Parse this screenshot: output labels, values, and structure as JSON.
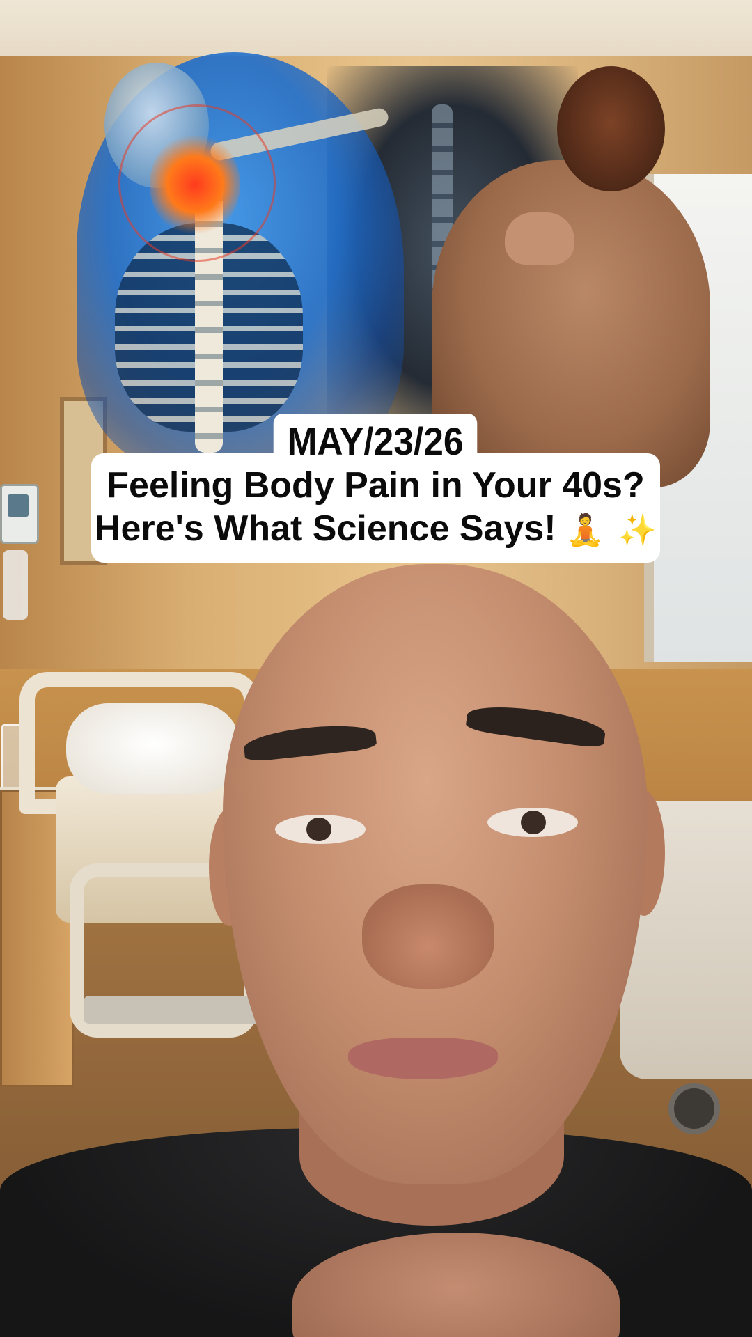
{
  "video": {
    "caption_date": "MAY/23/26",
    "caption_line1": "Feeling Body Pain in Your 40s?",
    "caption_line2": "Here's What Science Says!",
    "caption_emoji1": "🧘",
    "caption_emoji2": "✨"
  },
  "icons": {
    "emoji1": "person-meditating-emoji",
    "emoji2": "sparkles-emoji"
  },
  "colors": {
    "caption_background": "#ffffff",
    "caption_text": "#0b0b0b",
    "pain_highlight": "#ff3b1f",
    "anatomy_blue": "#1e6ecd"
  }
}
